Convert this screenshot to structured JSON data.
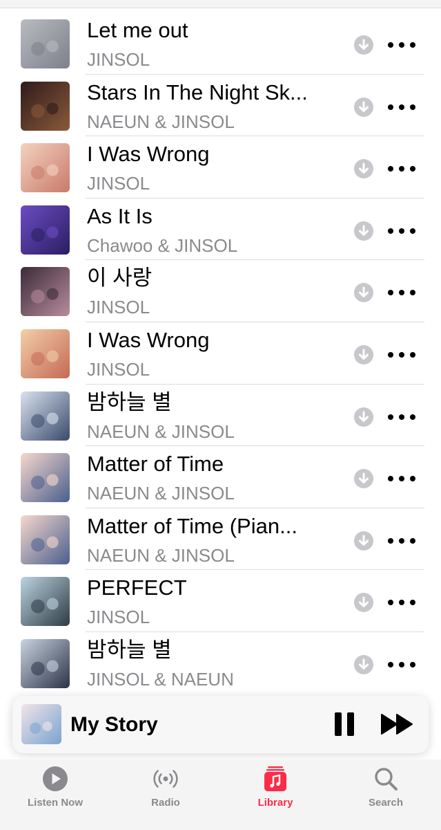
{
  "songs": [
    {
      "title": "Let me out",
      "artist": "JINSOL",
      "art_colors": [
        "#b9bbc2",
        "#7d8089"
      ]
    },
    {
      "title": "Stars In The Night Sk...",
      "artist": "NAEUN & JINSOL",
      "art_colors": [
        "#2f1b1b",
        "#8a5a3a"
      ]
    },
    {
      "title": "I Was Wrong",
      "artist": "JINSOL",
      "art_colors": [
        "#f4d2c0",
        "#c97a6a"
      ]
    },
    {
      "title": "As It Is",
      "artist": "Chawoo & JINSOL",
      "art_colors": [
        "#6b4cc2",
        "#2b1e63"
      ]
    },
    {
      "title": "이 사랑",
      "artist": "JINSOL",
      "art_colors": [
        "#3b2b38",
        "#b88c9d"
      ]
    },
    {
      "title": "I Was Wrong",
      "artist": "JINSOL",
      "art_colors": [
        "#f2cfa8",
        "#c56a55"
      ]
    },
    {
      "title": "밤하늘 별",
      "artist": "NAEUN & JINSOL",
      "art_colors": [
        "#d9e2ee",
        "#3a4a6b"
      ]
    },
    {
      "title": "Matter of Time",
      "artist": "NAEUN & JINSOL",
      "art_colors": [
        "#f6d8cc",
        "#4a5f8e"
      ]
    },
    {
      "title": "Matter of Time (Pian...",
      "artist": "NAEUN & JINSOL",
      "art_colors": [
        "#f6d8cc",
        "#4a5f8e"
      ]
    },
    {
      "title": "PERFECT",
      "artist": "JINSOL",
      "art_colors": [
        "#bcd3e0",
        "#2e3b44"
      ]
    },
    {
      "title": "밤하늘 별",
      "artist": "JINSOL & NAEUN",
      "art_colors": [
        "#c8d4e0",
        "#2c3347"
      ]
    }
  ],
  "now_playing": {
    "title": "My Story",
    "art_colors": [
      "#f1e4e8",
      "#7aa3d0"
    ]
  },
  "tabs": [
    {
      "label": "Listen Now",
      "icon": "play-circle-icon",
      "active": false
    },
    {
      "label": "Radio",
      "icon": "broadcast-icon",
      "active": false
    },
    {
      "label": "Library",
      "icon": "music-library-icon",
      "active": true
    },
    {
      "label": "Search",
      "icon": "magnifier-icon",
      "active": false
    }
  ],
  "colors": {
    "accent": "#fa2d48",
    "secondary_text": "#8a8a8e",
    "download_icon": "#c7c7cc"
  }
}
